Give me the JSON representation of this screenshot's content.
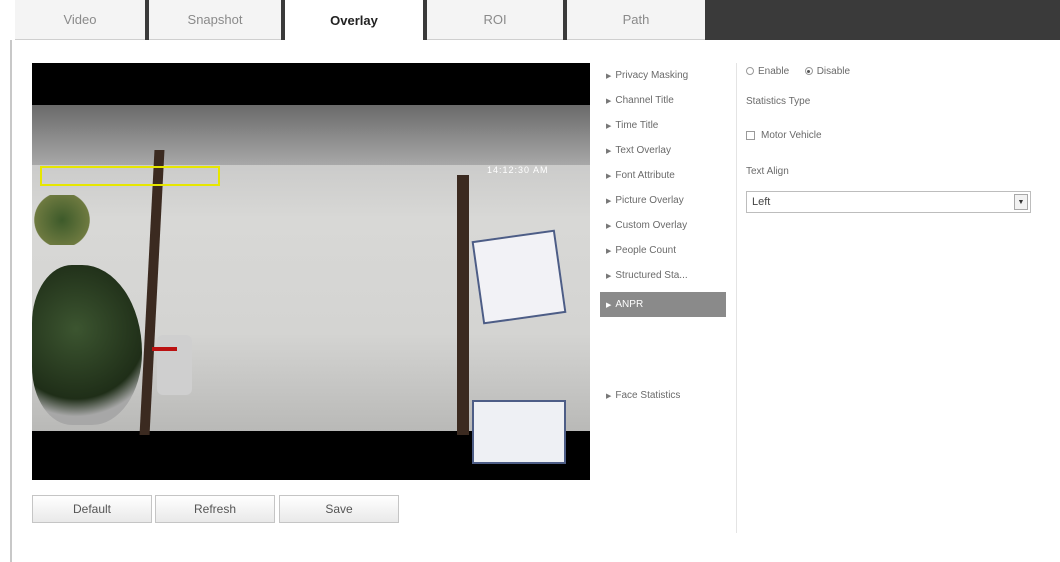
{
  "tabs": [
    {
      "label": "Video",
      "active": false
    },
    {
      "label": "Snapshot",
      "active": false
    },
    {
      "label": "Overlay",
      "active": true
    },
    {
      "label": "ROI",
      "active": false
    },
    {
      "label": "Path",
      "active": false
    }
  ],
  "video": {
    "osd_time": "14:12:30 AM"
  },
  "buttons": {
    "default": "Default",
    "refresh": "Refresh",
    "save": "Save"
  },
  "menu": {
    "items": [
      "Privacy Masking",
      "Channel Title",
      "Time Title",
      "Text Overlay",
      "Font Attribute",
      "Picture Overlay",
      "Custom Overlay",
      "People Count",
      "Structured Sta...",
      "ANPR",
      "Face Statistics"
    ],
    "active_index": 9
  },
  "settings": {
    "enable_label": "Enable",
    "disable_label": "Disable",
    "selected": "Disable",
    "statistics_type_label": "Statistics Type",
    "motor_vehicle_label": "Motor Vehicle",
    "motor_vehicle_checked": false,
    "text_align_label": "Text Align",
    "text_align_value": "Left"
  },
  "colors": {
    "tab_bar_dark": "#3a3a3a",
    "menu_active": "#8a8a8a",
    "overlay_box": "#e6e600"
  }
}
